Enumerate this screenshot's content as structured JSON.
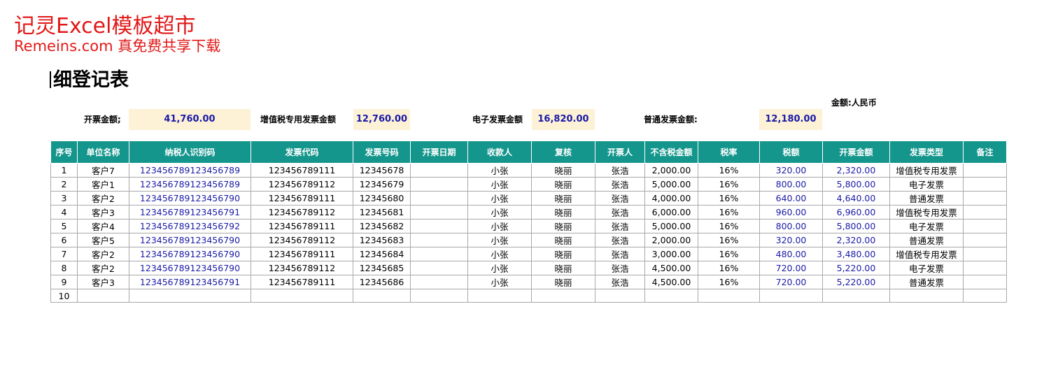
{
  "watermark": {
    "line1": "记灵Excel模板超市",
    "line2": "Remeins.com 真免费共享下载"
  },
  "title": "细登记表",
  "currency_note": "金额:人民币",
  "summary": [
    {
      "label": "开票金额;",
      "value": "41,760.00"
    },
    {
      "label": "增值税专用发票金额",
      "value": "12,760.00"
    },
    {
      "label": "电子发票金额",
      "value": "16,820.00"
    },
    {
      "label": "普通发票金额:",
      "value": "12,180.00"
    }
  ],
  "table": {
    "headers": [
      "序号",
      "单位名称",
      "纳税人识别码",
      "发票代码",
      "发票号码",
      "开票日期",
      "收款人",
      "复核",
      "开票人",
      "不含税金额",
      "税率",
      "税额",
      "开票金额",
      "发票类型",
      "备注"
    ],
    "rows": [
      [
        "1",
        "客户7",
        "123456789123456789",
        "123456789111",
        "12345678",
        "",
        "小张",
        "晓丽",
        "张浩",
        "2,000.00",
        "16%",
        "320.00",
        "2,320.00",
        "增值税专用发票",
        ""
      ],
      [
        "2",
        "客户1",
        "123456789123456789",
        "123456789112",
        "12345679",
        "",
        "小张",
        "晓丽",
        "张浩",
        "5,000.00",
        "16%",
        "800.00",
        "5,800.00",
        "电子发票",
        ""
      ],
      [
        "3",
        "客户2",
        "123456789123456790",
        "123456789111",
        "12345680",
        "",
        "小张",
        "晓丽",
        "张浩",
        "4,000.00",
        "16%",
        "640.00",
        "4,640.00",
        "普通发票",
        ""
      ],
      [
        "4",
        "客户3",
        "123456789123456791",
        "123456789112",
        "12345681",
        "",
        "小张",
        "晓丽",
        "张浩",
        "6,000.00",
        "16%",
        "960.00",
        "6,960.00",
        "增值税专用发票",
        ""
      ],
      [
        "5",
        "客户4",
        "123456789123456792",
        "123456789111",
        "12345682",
        "",
        "小张",
        "晓丽",
        "张浩",
        "5,000.00",
        "16%",
        "800.00",
        "5,800.00",
        "电子发票",
        ""
      ],
      [
        "6",
        "客户5",
        "123456789123456790",
        "123456789112",
        "12345683",
        "",
        "小张",
        "晓丽",
        "张浩",
        "2,000.00",
        "16%",
        "320.00",
        "2,320.00",
        "普通发票",
        ""
      ],
      [
        "7",
        "客户2",
        "123456789123456790",
        "123456789111",
        "12345684",
        "",
        "小张",
        "晓丽",
        "张浩",
        "3,000.00",
        "16%",
        "480.00",
        "3,480.00",
        "增值税专用发票",
        ""
      ],
      [
        "8",
        "客户2",
        "123456789123456790",
        "123456789112",
        "12345685",
        "",
        "小张",
        "晓丽",
        "张浩",
        "4,500.00",
        "16%",
        "720.00",
        "5,220.00",
        "电子发票",
        ""
      ],
      [
        "9",
        "客户3",
        "123456789123456791",
        "123456789111",
        "12345686",
        "",
        "小张",
        "晓丽",
        "张浩",
        "4,500.00",
        "16%",
        "720.00",
        "5,220.00",
        "普通发票",
        ""
      ],
      [
        "10",
        "",
        "",
        "",
        "",
        "",
        "",
        "",
        "",
        "",
        "",
        "",
        "",
        "",
        ""
      ]
    ]
  }
}
